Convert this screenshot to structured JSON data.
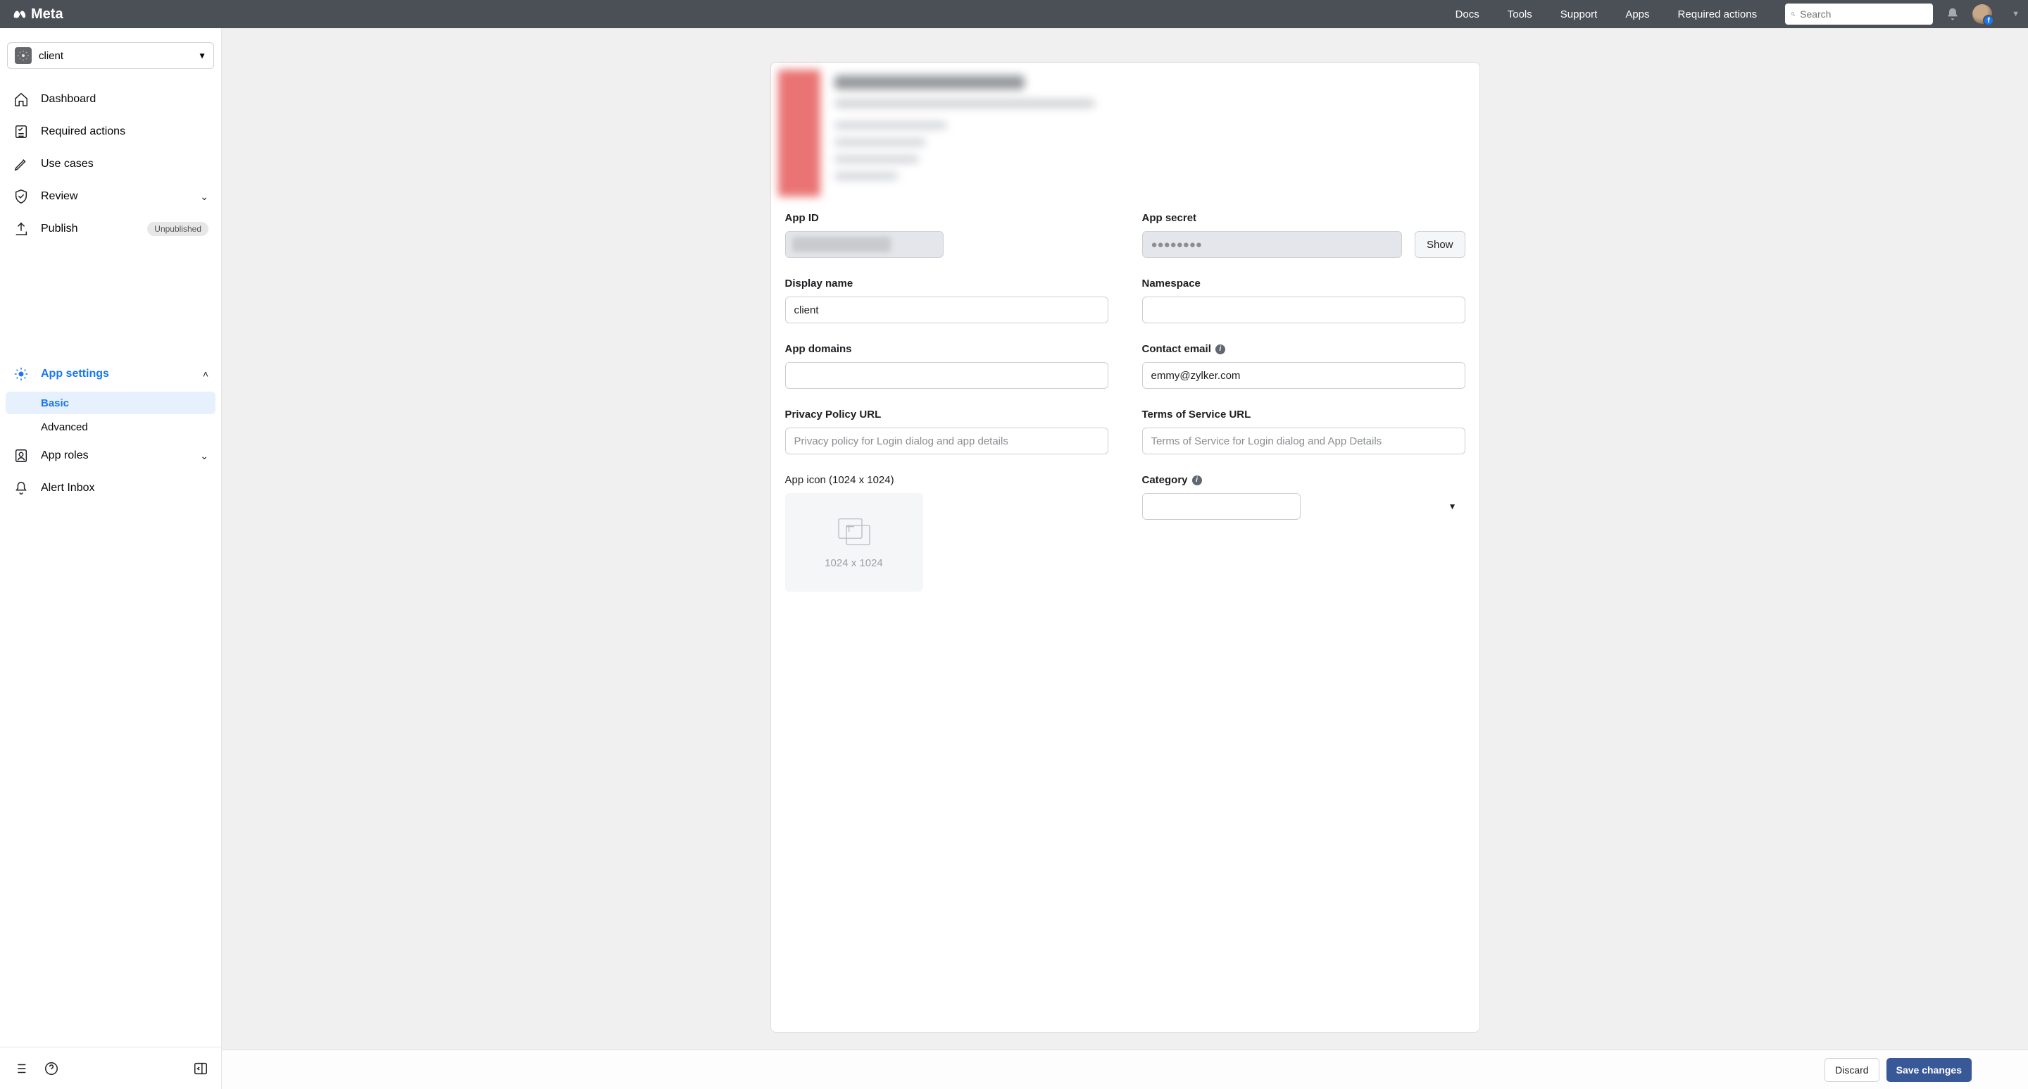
{
  "header": {
    "brand": "Meta",
    "nav": {
      "docs": "Docs",
      "tools": "Tools",
      "support": "Support",
      "apps": "Apps",
      "required_actions": "Required actions"
    },
    "search_placeholder": "Search"
  },
  "sidebar": {
    "app_selector_label": "client",
    "items": {
      "dashboard": "Dashboard",
      "required_actions": "Required actions",
      "use_cases": "Use cases",
      "review": "Review",
      "publish": "Publish",
      "publish_badge": "Unpublished",
      "app_settings": "App settings",
      "app_settings_sub_basic": "Basic",
      "app_settings_sub_advanced": "Advanced",
      "app_roles": "App roles",
      "alert_inbox": "Alert Inbox"
    }
  },
  "form": {
    "app_id_label": "App ID",
    "app_id_value": "",
    "app_secret_label": "App secret",
    "app_secret_value": "●●●●●●●●",
    "show_btn": "Show",
    "display_name_label": "Display name",
    "display_name_value": "client",
    "namespace_label": "Namespace",
    "namespace_value": "",
    "app_domains_label": "App domains",
    "app_domains_value": "",
    "contact_email_label": "Contact email",
    "contact_email_value": "emmy@zylker.com",
    "privacy_url_label": "Privacy Policy URL",
    "privacy_url_placeholder": "Privacy policy for Login dialog and app details",
    "tos_url_label": "Terms of Service URL",
    "tos_url_placeholder": "Terms of Service for Login dialog and App Details",
    "app_icon_label": "App icon (1024 x 1024)",
    "app_icon_hint": "1024 x 1024",
    "category_label": "Category",
    "category_value": ""
  },
  "footer": {
    "discard": "Discard",
    "save": "Save changes"
  }
}
